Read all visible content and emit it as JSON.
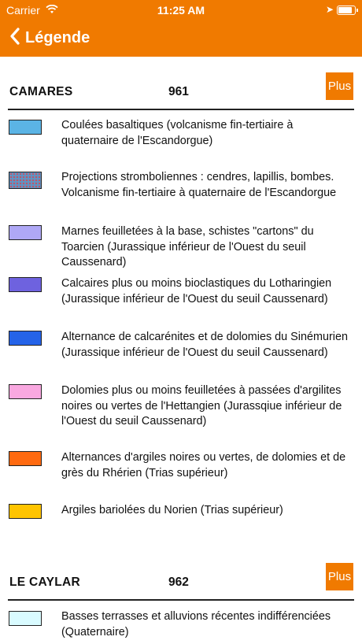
{
  "status": {
    "carrier": "Carrier",
    "time": "11:25 AM"
  },
  "nav": {
    "back_icon": "chevron-left-icon",
    "title": "Légende"
  },
  "colors": {
    "accent": "#F07A00"
  },
  "sections": [
    {
      "name": "CAMARES",
      "code": "961",
      "more_label": "Plus",
      "items": [
        {
          "color": "#5BB4E5",
          "text": "Coulées basaltiques (volcanisme fin-tertiaire à quaternaire de l'Escandorgue)"
        },
        {
          "color": "#5d95c5",
          "pattern": "dots",
          "text": "Projections stromboliennes : cendres, lapillis, bombes. Volcanisme fin-tertiaire à quaternaire de l'Escandorgue"
        },
        {
          "color": "#AFA8F6",
          "text": "Marnes feuilletées à la base, schistes \"cartons\" du Toarcien (Jurassique inférieur de l'Ouest du seuil Caussenard)"
        },
        {
          "color": "#6E62DF",
          "text": "Calcaires plus ou moins bioclastiques du Lotharingien (Jurassique inférieur de l'Ouest du seuil Caussenard)"
        },
        {
          "color": "#2463E8",
          "text": "Alternance de calcarénites et de dolomies du Sinémurien (Jurassique inférieur de l'Ouest du seuil Caussenard)"
        },
        {
          "color": "#F9A8E0",
          "text": "Dolomies plus ou moins feuilletées à passées d'argilites noires ou vertes de l'Hettangien (Jurassqiue inférieur de l'Ouest du seuil Caussenard)"
        },
        {
          "color": "#FF6A10",
          "text": "Alternances d'argiles noires ou vertes, de dolomies et de grès du Rhérien (Trias supérieur)"
        },
        {
          "color": "#FFC400",
          "text": "Argiles bariolées du Norien (Trias supérieur)"
        }
      ]
    },
    {
      "name": "LE CAYLAR",
      "code": "962",
      "more_label": "Plus",
      "items": [
        {
          "color": "#D9FBFF",
          "text": "Basses terrasses et alluvions récentes indifférenciées (Quaternaire)"
        }
      ]
    }
  ]
}
